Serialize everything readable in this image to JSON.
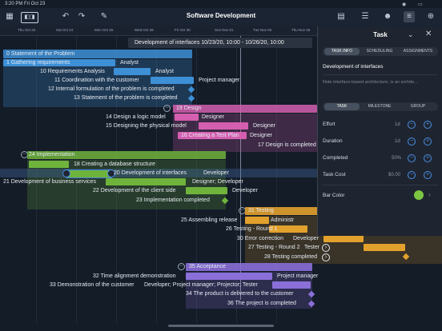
{
  "status": {
    "time": "3:20 PM",
    "date": "Fri Oct 23"
  },
  "app": {
    "title": "Software Development"
  },
  "toolbar": {
    "icons": [
      "grid-icon",
      "view-toggle-icon",
      "undo-icon",
      "redo-icon",
      "pencil-icon",
      "inbox-icon",
      "sliders-icon",
      "people-icon",
      "baseline-icon",
      "add-icon"
    ]
  },
  "timeline": {
    "dates": [
      "Thu Oct 22",
      "Sat Oct 24",
      "Mon Oct 26",
      "Wed Oct 28",
      "Fri Oct 30",
      "Sun Nov 01",
      "Tue Nov 03",
      "Thu Nov 05",
      "Sat Nov 07",
      "Mon Nov 09"
    ]
  },
  "tooltip": {
    "text": "Development of interfaces  10/23/20, 10:00 - 10/26/20, 10:00"
  },
  "tasks": {
    "t0": "0 Statement of the Problem",
    "t1": "1 Gathering requirements",
    "r1": "Analyst",
    "t10": "10 Requirements Analysis",
    "r10": "Analyst",
    "t11": "11 Coordination with the customer",
    "r11": "Project manager",
    "t12": "12 Internal formulation of the problem is completed",
    "t13": "13 Statement of the problem is completed",
    "t19": "19 Design",
    "t14": "14 Design a logic model",
    "r14": "Designer",
    "t15": "15 Designing the physical model",
    "r15": "Designer",
    "t16": "16 Creating a Test Plan",
    "r16": "Designer",
    "t17": "17 Design is completed",
    "t24": "24 Implementation",
    "t18": "18 Creating a database structure",
    "t20": "20 Development of interfaces",
    "r20": "Developer",
    "t21": "21 Development of business services",
    "r21": "Designer; Developer",
    "t22": "22 Development of the client side",
    "r22": "Developer",
    "t23": "23 Implementation completed",
    "t31": "31 Testing",
    "t25": "25 Assembling release",
    "r25": "Administr",
    "t26": "26 Testing - Round 1",
    "t30": "30 Error correction",
    "r30": "Developer",
    "t27": "27 Testing - Round 2",
    "r27": "Tester",
    "t28": "28 Testing completed",
    "t35": "35 Acceptance",
    "t32": "32 Time alignment demonstration",
    "r32": "Project manager",
    "t33": "33 Demonstration of the customer",
    "r33": "Developer; Project manager; Projector; Tester",
    "t34": "34 The product is delivered to the customer",
    "t36": "36 The project is completed"
  },
  "panel": {
    "title": "Task",
    "tabs": [
      "TASK INFO",
      "SCHEDULING",
      "ASSIGNMENTS"
    ],
    "task_name": "Development of interfaces",
    "note_placeholder": "Note   interface-based architecture, is an archite...",
    "type_tabs": [
      "TASK",
      "MILESTONE",
      "GROUP"
    ],
    "effort_label": "Effort",
    "effort_value": "1d",
    "duration_label": "Duration",
    "duration_value": "1d",
    "completed_label": "Completed",
    "completed_value": "50%",
    "cost_label": "Task Cost",
    "cost_value": "$0.00",
    "bar_color_label": "Bar Color",
    "bar_color": "#7cc542"
  },
  "colors": {
    "blue": "#3d8fd6",
    "pink": "#d45fb0",
    "green": "#6fb33c",
    "orange": "#e2a12c",
    "purple": "#8a6fd8"
  }
}
